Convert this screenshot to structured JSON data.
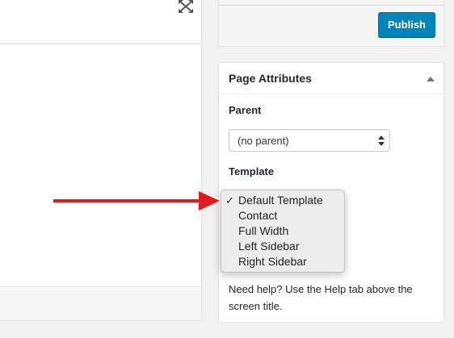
{
  "publish": {
    "button_label": "Publish"
  },
  "page_attributes": {
    "title": "Page Attributes",
    "parent_label": "Parent",
    "parent_value": "(no parent)",
    "template_label": "Template",
    "help_text": "Need help? Use the Help tab above the screen title."
  },
  "template_dropdown": {
    "selected": "Default Template",
    "options": [
      "Default Template",
      "Contact",
      "Full Width",
      "Left Sidebar",
      "Right Sidebar"
    ]
  },
  "icons": {
    "fullscreen": "fullscreen-icon",
    "collapse": "triangle-up-icon",
    "select_arrows": "updown-arrows-icon",
    "check": "checkmark-icon",
    "annotation_arrow": "red-arrow-icon"
  },
  "colors": {
    "publish": "#0085ba",
    "arrow": "#e11b22"
  }
}
